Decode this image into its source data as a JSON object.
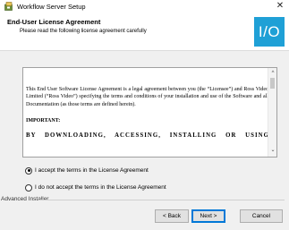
{
  "window": {
    "title": "Workflow Server Setup",
    "close_label": "✕",
    "app_icon": "installer-icon"
  },
  "banner": {
    "title": "End-User License Agreement",
    "subtitle": "Please read the following license agreement carefully",
    "logo_text": "I/O",
    "logo_color": "#1fa0d6"
  },
  "license": {
    "paragraph": "This End User Software License Agreement is a legal agreement between you (the “Licensee”) and Ross Video Limited (“Ross Video”) specifying the terms and conditions of your installation and use of the Software and all Documentation (as those terms are defined herein).",
    "important": "IMPORTANT:",
    "by_line": "BY DOWNLOADING, ACCESSING, INSTALLING OR USING THE",
    "scroll_up": "^",
    "scroll_down": "⌄"
  },
  "options": {
    "accept_label": "I accept the terms in the License Agreement",
    "accept_checked": true,
    "decline_label": "I do not accept the terms in the License Agreement",
    "decline_checked": false
  },
  "footer": {
    "brand": "Advanced Installer",
    "back_label": "< Back",
    "next_label": "Next >",
    "cancel_label": "Cancel"
  }
}
